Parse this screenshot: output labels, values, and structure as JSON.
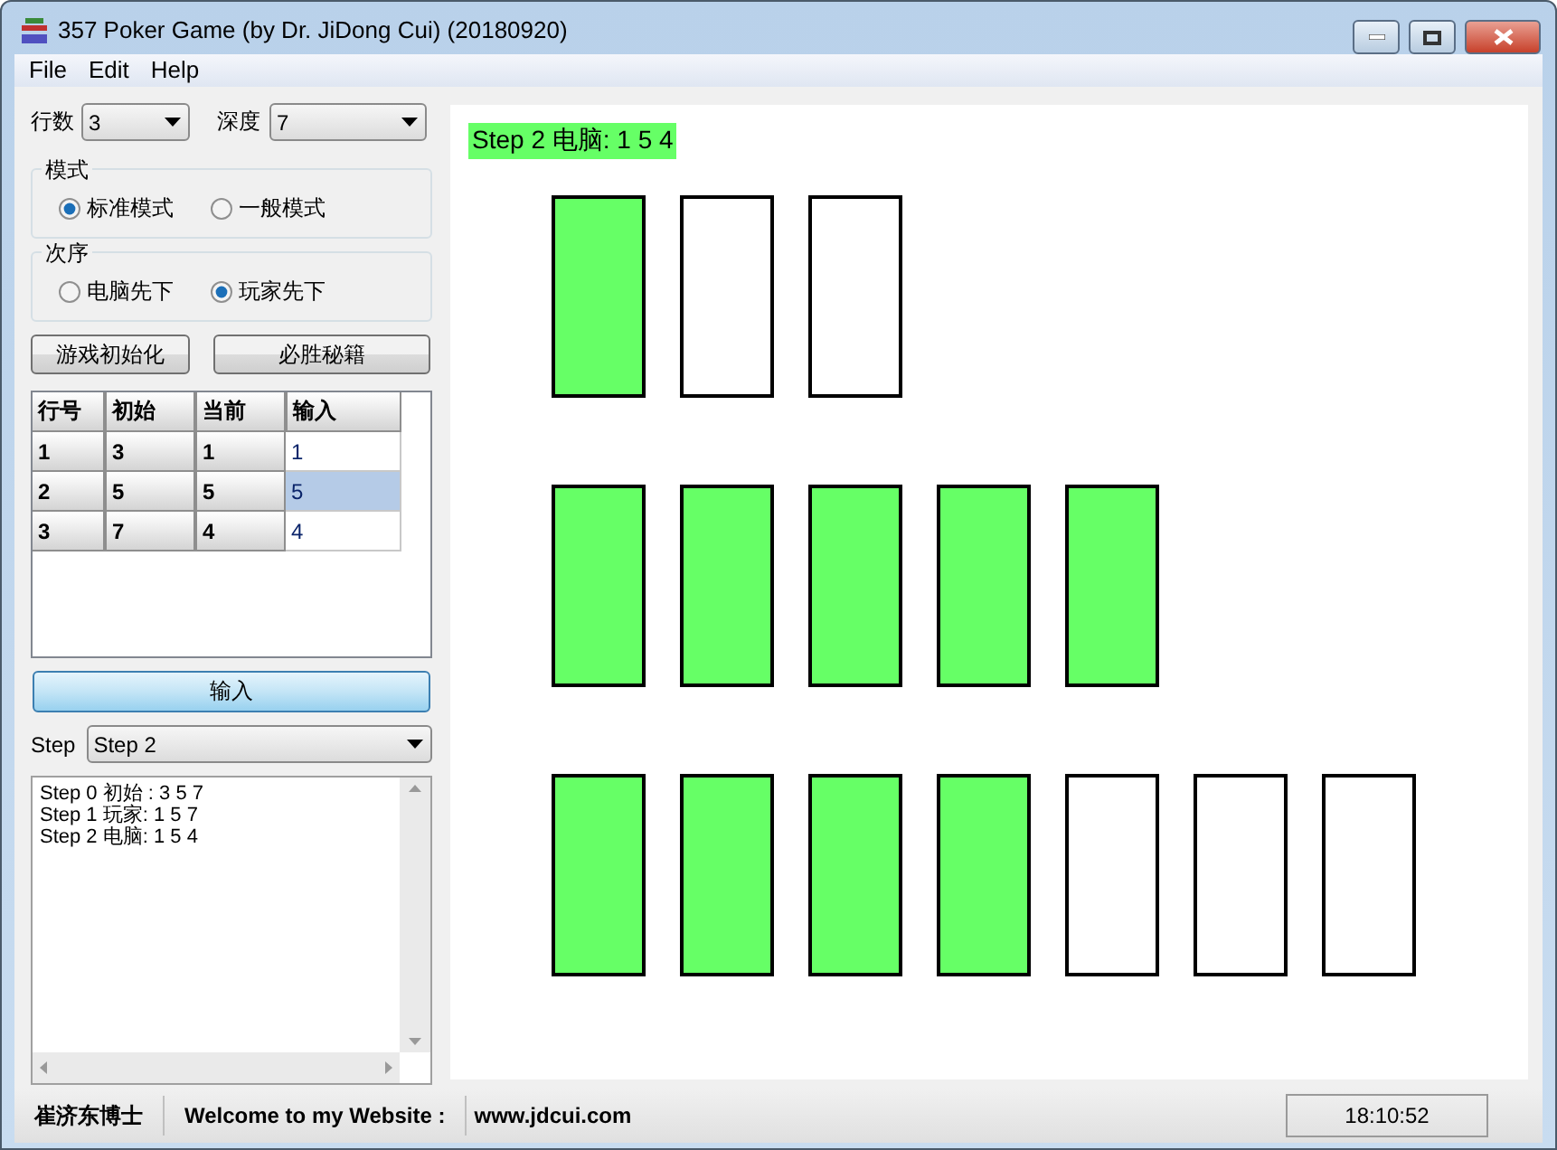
{
  "window": {
    "title": "357 Poker Game (by Dr. JiDong Cui) (20180920)"
  },
  "menu": [
    "File",
    "Edit",
    "Help"
  ],
  "settings": {
    "rows_label": "行数",
    "rows_value": "3",
    "depth_label": "深度",
    "depth_value": "7"
  },
  "mode_group": {
    "title": "模式",
    "options": [
      {
        "label": "标准模式",
        "selected": true
      },
      {
        "label": "一般模式",
        "selected": false
      }
    ]
  },
  "order_group": {
    "title": "次序",
    "options": [
      {
        "label": "电脑先下",
        "selected": false
      },
      {
        "label": "玩家先下",
        "selected": true
      }
    ]
  },
  "buttons": [
    "游戏初始化",
    "必胜秘籍"
  ],
  "table": {
    "columns": [
      "行号",
      "初始",
      "当前",
      "输入"
    ],
    "rows": [
      {
        "cells": [
          "1",
          "3",
          "1",
          "1"
        ],
        "selected": false
      },
      {
        "cells": [
          "2",
          "5",
          "5",
          "5"
        ],
        "selected": true
      },
      {
        "cells": [
          "3",
          "7",
          "4",
          "4"
        ],
        "selected": false
      }
    ]
  },
  "input_button": "输入",
  "step": {
    "label": "Step",
    "value": "Step 2"
  },
  "log": [
    "Step 0 初始 : 3 5 7",
    "Step 1 玩家: 1 5 7",
    "Step 2 电脑: 1 5 4"
  ],
  "board": {
    "status": "Step 2 电脑: 1 5 4",
    "rows": [
      {
        "cards": [
          {
            "filled": true
          },
          {
            "filled": false
          },
          {
            "filled": false
          }
        ]
      },
      {
        "cards": [
          {
            "filled": true
          },
          {
            "filled": true
          },
          {
            "filled": true
          },
          {
            "filled": true
          },
          {
            "filled": true
          }
        ]
      },
      {
        "cards": [
          {
            "filled": true
          },
          {
            "filled": true
          },
          {
            "filled": true
          },
          {
            "filled": true
          },
          {
            "filled": false
          },
          {
            "filled": false
          },
          {
            "filled": false
          }
        ]
      }
    ]
  },
  "status_bar": {
    "author": "崔济东博士",
    "welcome": "Welcome to my Website :",
    "website": "www.jdcui.com",
    "time": "18:10:52"
  }
}
